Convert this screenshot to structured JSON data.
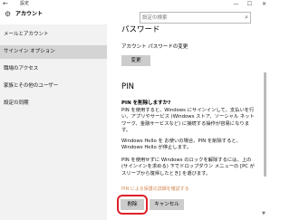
{
  "window": {
    "title": "設定",
    "back_icon": "arrow-left-icon",
    "controls": [
      "—",
      "☐",
      "✕"
    ]
  },
  "header": {
    "title": "アカウント",
    "icon": "gear-icon"
  },
  "search": {
    "placeholder": "設定の検索"
  },
  "sidebar": {
    "items": [
      {
        "label": "メールとアカウント",
        "selected": false
      },
      {
        "label": "サインイン オプション",
        "selected": true
      },
      {
        "label": "職場のアクセス",
        "selected": false
      },
      {
        "label": "家族とその他のユーザー",
        "selected": false
      },
      {
        "label": "設定の同期",
        "selected": false
      }
    ]
  },
  "password": {
    "heading": "パスワード",
    "label": "アカウント パスワードの変更",
    "change_button": "変更"
  },
  "pin": {
    "heading": "PIN",
    "question": "PIN を削除しますか?",
    "paragraph1": "PIN を使用すると、Windows にサインインして、支払いを行い、アプリやサービス (Windows ストア、ソーシャル ネットワーク、金融サービスなど) に接続する操作が容易になります。",
    "paragraph2": "Windows Hello を お使いの場合、PIN を削除すると、Windows Hello が停止します。",
    "paragraph3": "PIN を使用せずに Windows のロックを解除するには、上の (サインインを求める) 下でドロップダウン メニューの [PC がスリープから復帰したとき] を選びます。",
    "link": "PIN による保護の詳細を確認する",
    "remove_button": "削除",
    "cancel_button": "キャンセル"
  },
  "colors": {
    "highlight": "#e0202a",
    "link": "#d58a52",
    "sidebar_bg": "#f2f2f2",
    "sidebar_selected": "#d4d4d4"
  }
}
